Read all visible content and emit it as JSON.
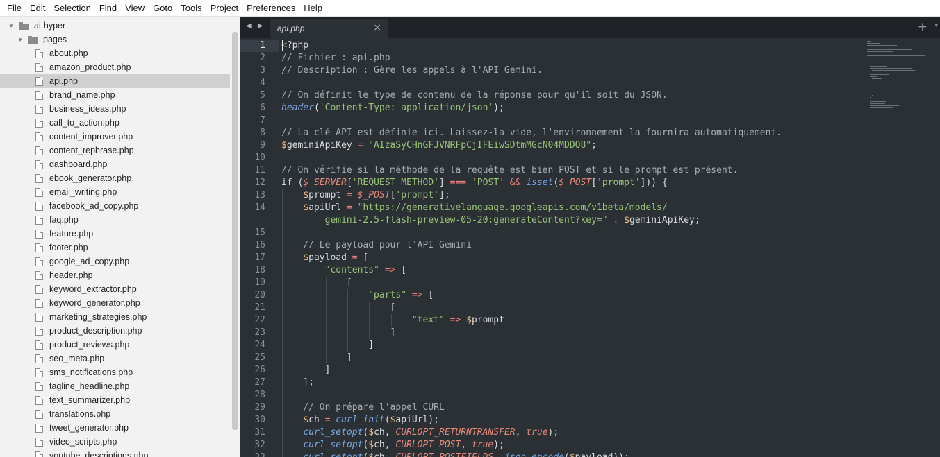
{
  "menu": [
    "File",
    "Edit",
    "Selection",
    "Find",
    "View",
    "Goto",
    "Tools",
    "Project",
    "Preferences",
    "Help"
  ],
  "sidebar": {
    "root": "ai-hyper",
    "folder": "pages",
    "selected": "api.php",
    "files": [
      "about.php",
      "amazon_product.php",
      "api.php",
      "brand_name.php",
      "business_ideas.php",
      "call_to_action.php",
      "content_improver.php",
      "content_rephrase.php",
      "dashboard.php",
      "ebook_generator.php",
      "email_writing.php",
      "facebook_ad_copy.php",
      "faq.php",
      "feature.php",
      "footer.php",
      "google_ad_copy.php",
      "header.php",
      "keyword_extractor.php",
      "keyword_generator.php",
      "marketing_strategies.php",
      "product_description.php",
      "product_reviews.php",
      "seo_meta.php",
      "sms_notifications.php",
      "tagline_headline.php",
      "text_summarizer.php",
      "translations.php",
      "tweet_generator.php",
      "video_scripts.php",
      "youtube_descriptions.php"
    ]
  },
  "tab": {
    "label": "api.php",
    "close_glyph": "×",
    "add_glyph": "+",
    "nav_glyph": "◀ ▶",
    "dropdown_glyph": "▾"
  },
  "editor": {
    "active_line": 1,
    "line_numbers": [
      "1",
      "2",
      "3",
      "4",
      "5",
      "6",
      "7",
      "8",
      "9",
      "10",
      "11",
      "12",
      "13",
      "14",
      "",
      "15",
      "16",
      "17",
      "18",
      "19",
      "20",
      "21",
      "22",
      "23",
      "24",
      "25",
      "26",
      "27",
      "28",
      "29",
      "30",
      "31",
      "32",
      "33"
    ],
    "lines": [
      [
        {
          "t": "<?php",
          "c": "c-kw"
        }
      ],
      [
        {
          "t": "// Fichier : api.php",
          "c": "c-comment"
        }
      ],
      [
        {
          "t": "// Description : Gère les appels à l'API Gemini.",
          "c": "c-comment"
        }
      ],
      [],
      [
        {
          "t": "// On définit le type de contenu de la réponse pour qu'il soit du JSON.",
          "c": "c-comment"
        }
      ],
      [
        {
          "t": "header",
          "c": "c-func"
        },
        {
          "t": "(",
          "c": "c-punc"
        },
        {
          "t": "'Content-Type: application/json'",
          "c": "c-str"
        },
        {
          "t": ");",
          "c": "c-punc"
        }
      ],
      [],
      [
        {
          "t": "// La clé API est définie ici. Laissez-la vide, l'environnement la fournira automatiquement.",
          "c": "c-comment"
        }
      ],
      [
        {
          "t": "$",
          "c": "c-var"
        },
        {
          "t": "geminiApiKey",
          "c": "c-varname"
        },
        {
          "t": " = ",
          "c": "c-op"
        },
        {
          "t": "\"AIzaSyCHnGFJVNRFpCjIFEiwSDtmMGcN04MDDQ8\"",
          "c": "c-str"
        },
        {
          "t": ";",
          "c": "c-punc"
        }
      ],
      [],
      [
        {
          "t": "// On vérifie si la méthode de la requête est bien POST et si le prompt est présent.",
          "c": "c-comment"
        }
      ],
      [
        {
          "t": "if (",
          "c": "c-kw"
        },
        {
          "t": "$_SERVER",
          "c": "c-sup"
        },
        {
          "t": "[",
          "c": "c-punc"
        },
        {
          "t": "'REQUEST_METHOD'",
          "c": "c-str"
        },
        {
          "t": "] ",
          "c": "c-punc"
        },
        {
          "t": "===",
          "c": "c-op"
        },
        {
          "t": " ",
          "c": "c-punc"
        },
        {
          "t": "'POST'",
          "c": "c-str"
        },
        {
          "t": " ",
          "c": "c-punc"
        },
        {
          "t": "&&",
          "c": "c-op"
        },
        {
          "t": " ",
          "c": "c-punc"
        },
        {
          "t": "isset",
          "c": "c-func"
        },
        {
          "t": "(",
          "c": "c-punc"
        },
        {
          "t": "$_POST",
          "c": "c-sup"
        },
        {
          "t": "[",
          "c": "c-punc"
        },
        {
          "t": "'prompt'",
          "c": "c-str"
        },
        {
          "t": "])) {",
          "c": "c-punc"
        }
      ],
      [
        {
          "t": "    ",
          "c": "c-punc"
        },
        {
          "t": "$",
          "c": "c-var"
        },
        {
          "t": "prompt",
          "c": "c-varname"
        },
        {
          "t": " = ",
          "c": "c-op"
        },
        {
          "t": "$_POST",
          "c": "c-sup"
        },
        {
          "t": "[",
          "c": "c-punc"
        },
        {
          "t": "'prompt'",
          "c": "c-str"
        },
        {
          "t": "];",
          "c": "c-punc"
        }
      ],
      [
        {
          "t": "    ",
          "c": "c-punc"
        },
        {
          "t": "$",
          "c": "c-var"
        },
        {
          "t": "apiUrl",
          "c": "c-varname"
        },
        {
          "t": " = ",
          "c": "c-op"
        },
        {
          "t": "\"https://generativelanguage.googleapis.com/v1beta/models/",
          "c": "c-str"
        }
      ],
      [
        {
          "t": "        ",
          "c": "c-punc"
        },
        {
          "t": "gemini-2.5-flash-preview-05-20:generateContent?key=\"",
          "c": "c-str"
        },
        {
          "t": " . ",
          "c": "c-op"
        },
        {
          "t": "$",
          "c": "c-var"
        },
        {
          "t": "geminiApiKey",
          "c": "c-varname"
        },
        {
          "t": ";",
          "c": "c-punc"
        }
      ],
      [],
      [
        {
          "t": "    ",
          "c": "c-punc"
        },
        {
          "t": "// Le payload pour l'API Gemini",
          "c": "c-comment"
        }
      ],
      [
        {
          "t": "    ",
          "c": "c-punc"
        },
        {
          "t": "$",
          "c": "c-var"
        },
        {
          "t": "payload",
          "c": "c-varname"
        },
        {
          "t": " = ",
          "c": "c-op"
        },
        {
          "t": "[",
          "c": "c-punc"
        }
      ],
      [
        {
          "t": "        ",
          "c": "c-punc"
        },
        {
          "t": "\"contents\"",
          "c": "c-str"
        },
        {
          "t": " => ",
          "c": "c-op"
        },
        {
          "t": "[",
          "c": "c-punc"
        }
      ],
      [
        {
          "t": "            [",
          "c": "c-punc"
        }
      ],
      [
        {
          "t": "                ",
          "c": "c-punc"
        },
        {
          "t": "\"parts\"",
          "c": "c-str"
        },
        {
          "t": " => ",
          "c": "c-op"
        },
        {
          "t": "[",
          "c": "c-punc"
        }
      ],
      [
        {
          "t": "                    [",
          "c": "c-punc"
        }
      ],
      [
        {
          "t": "                        ",
          "c": "c-punc"
        },
        {
          "t": "\"text\"",
          "c": "c-str"
        },
        {
          "t": " => ",
          "c": "c-op"
        },
        {
          "t": "$",
          "c": "c-var"
        },
        {
          "t": "prompt",
          "c": "c-varname"
        }
      ],
      [
        {
          "t": "                    ]",
          "c": "c-punc"
        }
      ],
      [
        {
          "t": "                ]",
          "c": "c-punc"
        }
      ],
      [
        {
          "t": "            ]",
          "c": "c-punc"
        }
      ],
      [
        {
          "t": "        ]",
          "c": "c-punc"
        }
      ],
      [
        {
          "t": "    ];",
          "c": "c-punc"
        }
      ],
      [],
      [
        {
          "t": "    ",
          "c": "c-punc"
        },
        {
          "t": "// On prépare l'appel CURL",
          "c": "c-comment"
        }
      ],
      [
        {
          "t": "    ",
          "c": "c-punc"
        },
        {
          "t": "$",
          "c": "c-var"
        },
        {
          "t": "ch",
          "c": "c-varname"
        },
        {
          "t": " = ",
          "c": "c-op"
        },
        {
          "t": "curl_init",
          "c": "c-func"
        },
        {
          "t": "(",
          "c": "c-punc"
        },
        {
          "t": "$",
          "c": "c-var"
        },
        {
          "t": "apiUrl",
          "c": "c-varname"
        },
        {
          "t": ");",
          "c": "c-punc"
        }
      ],
      [
        {
          "t": "    ",
          "c": "c-punc"
        },
        {
          "t": "curl_setopt",
          "c": "c-func"
        },
        {
          "t": "(",
          "c": "c-punc"
        },
        {
          "t": "$",
          "c": "c-var"
        },
        {
          "t": "ch, ",
          "c": "c-varname"
        },
        {
          "t": "CURLOPT_RETURNTRANSFER",
          "c": "c-const"
        },
        {
          "t": ", ",
          "c": "c-punc"
        },
        {
          "t": "true",
          "c": "c-bool"
        },
        {
          "t": ");",
          "c": "c-punc"
        }
      ],
      [
        {
          "t": "    ",
          "c": "c-punc"
        },
        {
          "t": "curl_setopt",
          "c": "c-func"
        },
        {
          "t": "(",
          "c": "c-punc"
        },
        {
          "t": "$",
          "c": "c-var"
        },
        {
          "t": "ch, ",
          "c": "c-varname"
        },
        {
          "t": "CURLOPT_POST",
          "c": "c-const"
        },
        {
          "t": ", ",
          "c": "c-punc"
        },
        {
          "t": "true",
          "c": "c-bool"
        },
        {
          "t": ");",
          "c": "c-punc"
        }
      ],
      [
        {
          "t": "    ",
          "c": "c-punc"
        },
        {
          "t": "curl_setopt",
          "c": "c-func"
        },
        {
          "t": "(",
          "c": "c-punc"
        },
        {
          "t": "$",
          "c": "c-var"
        },
        {
          "t": "ch, ",
          "c": "c-varname"
        },
        {
          "t": "CURLOPT_POSTFIELDS",
          "c": "c-const"
        },
        {
          "t": ", ",
          "c": "c-punc"
        },
        {
          "t": "json_encode",
          "c": "c-func"
        },
        {
          "t": "(",
          "c": "c-punc"
        },
        {
          "t": "$",
          "c": "c-var"
        },
        {
          "t": "payload",
          "c": "c-varname"
        },
        {
          "t": "));",
          "c": "c-punc"
        }
      ]
    ]
  }
}
